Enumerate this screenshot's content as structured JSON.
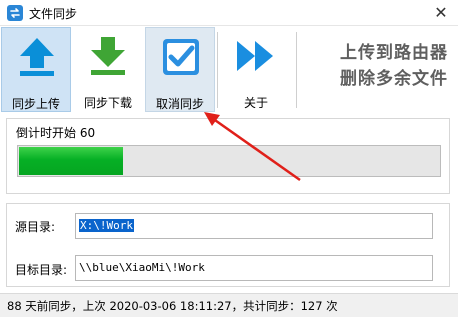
{
  "window": {
    "title": "文件同步",
    "close_glyph": "✕"
  },
  "toolbar": {
    "buttons": [
      {
        "label": "同步上传",
        "icon": "upload-arrow-icon",
        "color": "#0a8fd8"
      },
      {
        "label": "同步下载",
        "icon": "download-arrow-icon",
        "color": "#3fa535"
      },
      {
        "label": "取消同步",
        "icon": "checkbox-check-icon",
        "color": "#2b8fe0"
      },
      {
        "label": "关于",
        "icon": "double-arrow-icon",
        "color": "#1a8ee0"
      }
    ],
    "promo_lines": [
      "上传到路由器",
      "删除多余文件"
    ]
  },
  "progress": {
    "label": "倒计时开始 60",
    "fraction": 0.25,
    "color": "#06b025"
  },
  "directories": {
    "source_label": "源目录:",
    "source_value": "X:\\!Work",
    "target_label": "目标目录:",
    "target_value": "\\\\blue\\XiaoMi\\!Work"
  },
  "status": {
    "text": "88 天前同步，上次 2020-03-06 18:11:27，共计同步：127 次"
  }
}
